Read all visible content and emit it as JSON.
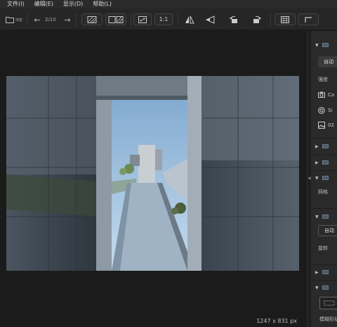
{
  "menu": [
    {
      "label": "文件(I)"
    },
    {
      "label": "编辑(E)"
    },
    {
      "label": "显示(D)"
    },
    {
      "label": "帮助(L)"
    }
  ],
  "toolbar": {
    "folder_label": "浏览",
    "image_counter": "2/10",
    "zoom_label": "1:1"
  },
  "status": {
    "image_size": "1247 x 831 px"
  },
  "panel": {
    "auto_button": "自动",
    "strength_label": "强度",
    "meta_camera": "Ca",
    "meta_lens": "Si",
    "meta_file": "02",
    "grid_label": "网格",
    "auto_outline_button": "自动",
    "rotate_label": "旋转",
    "bottom_label": "模糊形状"
  },
  "colors": {
    "app_bg": "#1a1a1a",
    "toolbar_bg": "#262626",
    "panel_bg": "#2a2a2a",
    "sky": "#8ab0d0"
  }
}
